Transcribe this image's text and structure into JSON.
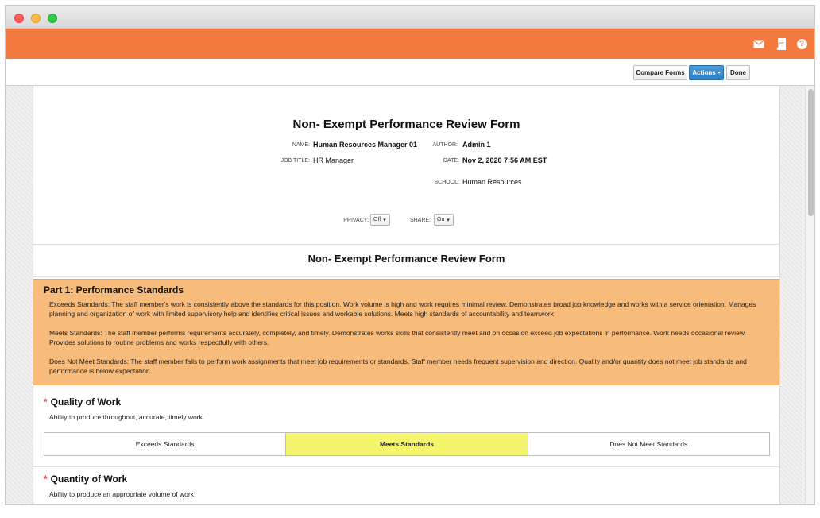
{
  "toolbar": {
    "compare_forms": "Compare Forms",
    "actions": "Actions",
    "done": "Done"
  },
  "icons": [
    "mail-icon",
    "book-icon",
    "help-icon"
  ],
  "colors": {
    "brand": "#f47b3f",
    "accent": "#2f7fc2",
    "section_bg": "#f7bb7b",
    "selected_rating": "#f4f56d"
  },
  "form": {
    "title": "Non- Exempt Performance Review Form",
    "name_label": "NAME:",
    "name_value": "Human Resources Manager 01",
    "author_label": "AUTHOR:",
    "author_value": "Admin 1",
    "job_title_label": "JOB TITLE:",
    "job_title_value": "HR Manager",
    "date_label": "DATE:",
    "date_value": "Nov 2, 2020 7:56 AM EST",
    "school_label": "SCHOOL:",
    "school_value": "Human Resources",
    "privacy_label": "PRIVACY:",
    "privacy_value": "Off",
    "share_label": "SHARE:",
    "share_value": "On"
  },
  "section_title": "Non- Exempt Performance Review Form",
  "part1": {
    "title": "Part 1: Performance Standards",
    "exceeds": "Exceeds Standards: The staff member's work is consistently above the standards for this position. Work volume is high and work requires minimal review. Demonstrates broad job knowledge and works with a service orientation. Manages planning and organization of work with limited supervisory help and identifies critical issues and workable solutions. Meets high standards of accountability and teamwork",
    "meets": "Meets Standards: The staff member performs requirements accurately, completely, and timely. Demonstrates works skills that consistently meet and on occasion exceed job expectations in performance. Work needs occasional review. Provides solutions to routine problems and works respectfully with others.",
    "not_meets": "Does Not Meet Standards: The staff member fails to perform work assignments that meet job requirements or standards. Staff member needs frequent supervision and direction. Quality and/or quantity does not meet job standards and performance is below expectation."
  },
  "questions": [
    {
      "required_mark": "*",
      "title": "Quality of Work",
      "description": "Ability to produce throughout, accurate, timely work.",
      "options": [
        "Exceeds Standards",
        "Meets Standards",
        "Does Not Meet Standards"
      ],
      "selected": "Meets Standards"
    },
    {
      "required_mark": "*",
      "title": "Quantity of Work",
      "description": "Ability to produce an appropriate volume of work"
    }
  ]
}
